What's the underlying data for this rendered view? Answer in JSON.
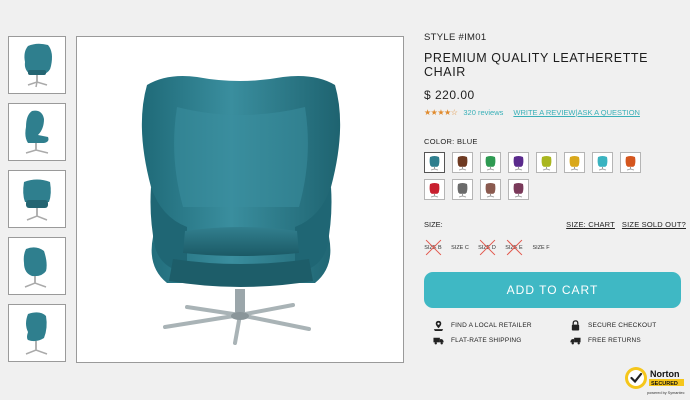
{
  "gallery": {
    "thumbnail_count": 5,
    "selected_color": "#2f7f8e"
  },
  "product": {
    "style": "STYLE #IM01",
    "title": "PREMIUM QUALITY LEATHERETTE CHAIR",
    "price": "$ 220.00",
    "rating": {
      "stars": "★★★★☆",
      "value": 4,
      "out_of": 5
    },
    "reviews": "320 reviews",
    "write_review": "WRITE A REVIEW",
    "separator": "|",
    "ask_question": "ASK A QUESTION"
  },
  "color": {
    "label": "COLOR: BLUE",
    "swatches": [
      {
        "name": "blue",
        "hex": "#2f7f8e",
        "selected": true
      },
      {
        "name": "brown",
        "hex": "#6e3a22"
      },
      {
        "name": "green",
        "hex": "#2e9a52"
      },
      {
        "name": "purple",
        "hex": "#5a2a8c"
      },
      {
        "name": "lime",
        "hex": "#a9b61f"
      },
      {
        "name": "yellow",
        "hex": "#d9a81c"
      },
      {
        "name": "teal",
        "hex": "#3ab3c0"
      },
      {
        "name": "orange",
        "hex": "#d4561e"
      },
      {
        "name": "red",
        "hex": "#c8202f"
      },
      {
        "name": "grey",
        "hex": "#6b6b6b"
      },
      {
        "name": "mauve",
        "hex": "#8a5a4f"
      },
      {
        "name": "plum",
        "hex": "#7a3a5a"
      }
    ]
  },
  "size": {
    "label": "SIZE:",
    "chart_link": "SIZE: CHART",
    "sold_out_link": "SIZE SOLD OUT?",
    "options": [
      {
        "label": "SIZE B",
        "available": false
      },
      {
        "label": "SIZE C",
        "available": true
      },
      {
        "label": "SIZE D",
        "available": false
      },
      {
        "label": "SIZE E",
        "available": false
      },
      {
        "label": "SIZE F",
        "available": true
      }
    ]
  },
  "cart": {
    "label": "ADD TO CART",
    "color": "#3fb8c4"
  },
  "features": {
    "retailer": "FIND A LOCAL RETAILER",
    "checkout": "SECURE CHECKOUT",
    "shipping": "FLAT-RATE SHIPPING",
    "returns": "FREE RETURNS"
  },
  "badge": {
    "brand": "Norton",
    "secured": "SECURED",
    "powered_by": "powered by Symantec"
  }
}
